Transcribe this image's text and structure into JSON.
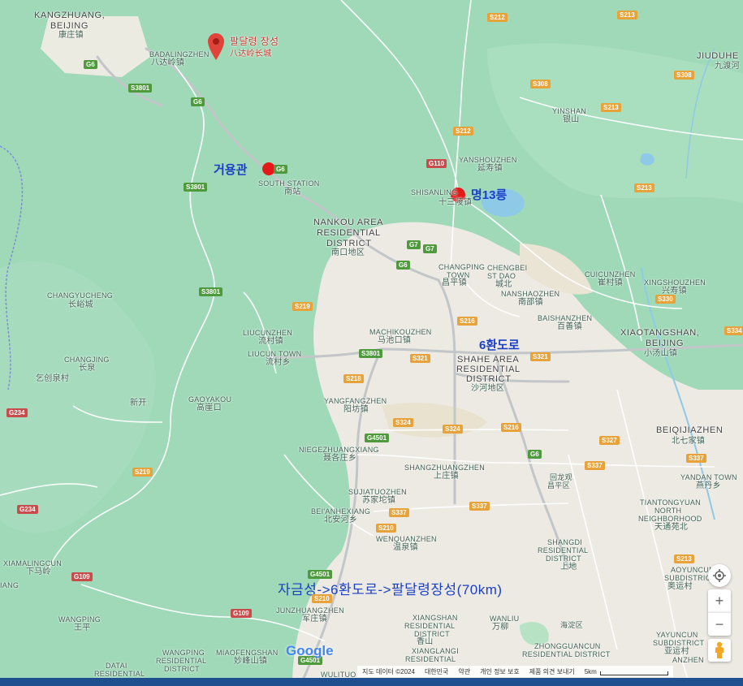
{
  "pins": {
    "badaling": {
      "title": "팔달령 장성",
      "subtitle": "八达岭长城"
    },
    "juyongguan": {
      "label": "거용관"
    },
    "ming13": {
      "label": "명13릉"
    }
  },
  "annotations": {
    "ring6": "6환도로",
    "route": "자금성->6환도로->팔달령장성(70km)"
  },
  "places": {
    "kangzhuang_en": "KANGZHUANG,",
    "kangzhuang_en2": "BEIJING",
    "kangzhuang_cn": "康庄镇",
    "badaling_en": "BADALINGZHEN",
    "badaling_cn": "八达岭镇",
    "jiudu_en": "JIUDUHE",
    "jiudu_cn": "九渡河",
    "yinshan_en": "YINSHAN",
    "yinshan_cn": "银山",
    "yanshou_en": "YANSHOUZHEN",
    "yanshou_cn": "延寿镇",
    "south_station_en": "SOUTH STATION",
    "south_station_cn": "南站",
    "shisan_en": "SHISANLING",
    "shisan_cn": "十三陵镇",
    "nankou1": "NANKOU AREA",
    "nankou2": "RESIDENTIAL",
    "nankou3": "DISTRICT",
    "nankou_cn": "南口地区",
    "changping_en": "CHANGPING",
    "changping_en2": "TOWN",
    "changping_cn": "昌平镇",
    "chengbei_en": "CHENGBEI",
    "chengbei_en2": "ST DAO",
    "chengbei_cn": "城北",
    "cuicun_en": "CUICUNZHEN",
    "cuicun_cn": "崔村镇",
    "xingshou_en": "XINGSHOUZHEN",
    "xingshou_cn": "兴寿镇",
    "nanshao_en": "NANSHAOZHEN",
    "nanshao_cn": "南邵镇",
    "changyu_en": "CHANGYUCHENG",
    "changyu_cn": "长峪城",
    "baishan_en": "BAISHANZHEN",
    "baishan_cn": "百善镇",
    "liucun_en": "LIUCUNZHEN",
    "liucun_cn": "流村镇",
    "liucun_town_en": "LIUCUN TOWN",
    "liucun_town_cn": "流村乡",
    "machi_en": "MACHIKOUZHEN",
    "machi_cn": "马池口镇",
    "xiaotang_en": "XIAOTANGSHAN,",
    "xiaotang_en2": "BEIJING",
    "xiaotang_cn": "小汤山镇",
    "changjing_en": "CHANGJING",
    "changjing_cn": "长泉",
    "shahe1": "SHAHE AREA",
    "shahe2": "RESIDENTIAL",
    "shahe3": "DISTRICT",
    "shahe_cn": "沙河地区",
    "qiying_cn": "乞创泉村",
    "xinkai_cn": "新开",
    "gaoyakou_en": "GAOYAKOU",
    "gaoyakou_cn": "高崖口",
    "yangfang_en": "YANGFANGZHEN",
    "yangfang_cn": "阳坊镇",
    "beiqijia_en": "BEIQIJIAZHEN",
    "beiqijia_cn": "北七家镇",
    "niege_en": "NIEGEZHUANGXIANG",
    "niege_cn": "聂各庄乡",
    "shangzhuang_en": "SHANGZHUANGZHEN",
    "shangzhuang_cn": "上庄镇",
    "huilongguan_cn": "回龙观",
    "yandan_en": "YANDAN TOWN",
    "yandan_cn": "燕丹乡",
    "sujia_en": "SUJIATUOZHEN",
    "sujia_cn": "苏家坨镇",
    "beian_en": "BEI'ANHEXIANG",
    "beian_cn": "北安河乡",
    "tiantong1": "TIANTONGYUAN",
    "tiantong2": "NORTH",
    "tiantong3": "NEIGHBORHOOD",
    "tiantong_cn": "天通苑北",
    "wenquan_en": "WENQUANZHEN",
    "wenquan_cn": "温泉镇",
    "shangdi1": "SHANGDI",
    "shangdi2": "RESIDENTIAL",
    "shangdi3": "DISTRICT",
    "shangdi_cn": "上地",
    "xiamaling_en": "XIAMALINGCUN",
    "xiamaling_cn": "下马岭",
    "aoyuncun1": "AOYUNCUN",
    "aoyuncun2": "SUBDISTRICT",
    "aoyuncun_cn": "奥运村",
    "junzhuang_en": "JUNZHUANGZHEN",
    "junzhuang_cn": "军庄镇",
    "xiangshan1": "XIANGSHAN",
    "xiangshan2": "RESIDENTIAL",
    "xiangshan3": "DISTRICT",
    "xiangshan_cn": "香山",
    "wanliu_en": "WANLIU",
    "wanliu_cn": "万柳",
    "haidian_cn": "海淀区",
    "wangping_en": "WANGPING",
    "wangping_cn": "王平",
    "wangping2_1": "WANGPING",
    "wangping2_2": "RESIDENTIAL",
    "wangping2_3": "DISTRICT",
    "miaofeng_en": "MIAOFENGSHAN",
    "miaofeng_cn": "妙峰山镇",
    "yayuncun1": "YAYUNCUN",
    "yayuncun2": "SUBDISTRICT",
    "yayuncun_cn": "亚运村",
    "zhongguancun1": "ZHONGGUANCUN",
    "zhongguancun2": "RESIDENTIAL DISTRICT",
    "xianglangi1": "XIANGLANGI",
    "xianglangi2": "RESIDENTIAL",
    "datai1": "DATAI",
    "datai2": "RESIDENTIAL",
    "wulituo": "WULITUO",
    "anzhen": "ANZHEN",
    "changping_district": "昌平区",
    "yang_l": "IANG"
  },
  "shields": [
    {
      "id": "S212a",
      "text": "S212"
    },
    {
      "id": "S213a",
      "text": "S213"
    },
    {
      "id": "S308a",
      "text": "S308"
    },
    {
      "id": "S308b",
      "text": "S308"
    },
    {
      "id": "S213b",
      "text": "S213"
    },
    {
      "id": "S212b",
      "text": "S212"
    },
    {
      "id": "G110",
      "text": "G110"
    },
    {
      "id": "G6a",
      "text": "G6"
    },
    {
      "id": "S3801a",
      "text": "S3801"
    },
    {
      "id": "G6b",
      "text": "G6"
    },
    {
      "id": "G6c",
      "text": "G6"
    },
    {
      "id": "S3801b",
      "text": "S3801"
    },
    {
      "id": "S213c",
      "text": "S213"
    },
    {
      "id": "G7a",
      "text": "G7"
    },
    {
      "id": "G7b",
      "text": "G7"
    },
    {
      "id": "G6d",
      "text": "G6"
    },
    {
      "id": "S3801c",
      "text": "S3801"
    },
    {
      "id": "S219a",
      "text": "S219"
    },
    {
      "id": "S330",
      "text": "S330"
    },
    {
      "id": "S216a",
      "text": "S216"
    },
    {
      "id": "S3801d",
      "text": "S3801"
    },
    {
      "id": "S321a",
      "text": "S321"
    },
    {
      "id": "S321b",
      "text": "S321"
    },
    {
      "id": "S334",
      "text": "S334"
    },
    {
      "id": "S218",
      "text": "S218"
    },
    {
      "id": "G234a",
      "text": "G234"
    },
    {
      "id": "S324a",
      "text": "S324"
    },
    {
      "id": "S324b",
      "text": "S324"
    },
    {
      "id": "S216b",
      "text": "S216"
    },
    {
      "id": "G4501a",
      "text": "G4501"
    },
    {
      "id": "S327",
      "text": "S327"
    },
    {
      "id": "G6e",
      "text": "G6"
    },
    {
      "id": "S337a",
      "text": "S337"
    },
    {
      "id": "S337b",
      "text": "S337"
    },
    {
      "id": "S219b",
      "text": "S219"
    },
    {
      "id": "G234b",
      "text": "G234"
    },
    {
      "id": "S337c",
      "text": "S337"
    },
    {
      "id": "S337d",
      "text": "S337"
    },
    {
      "id": "S210a",
      "text": "S210"
    },
    {
      "id": "S213d",
      "text": "S213"
    },
    {
      "id": "G4501b",
      "text": "G4501"
    },
    {
      "id": "G109a",
      "text": "G109"
    },
    {
      "id": "S210b",
      "text": "S210"
    },
    {
      "id": "G109b",
      "text": "G109"
    },
    {
      "id": "G4501c",
      "text": "G4501"
    }
  ],
  "controls": {
    "zoom_in": "+",
    "zoom_out": "−"
  },
  "google_logo": "Google",
  "footer": {
    "map_data": "지도 데이터 ©2024",
    "country": "대한민국",
    "terms": "약관",
    "privacy": "개인 정보 보호",
    "feedback": "제품 의견 보내기",
    "scale": "5km"
  },
  "colors": {
    "pin": "#e41a1a",
    "annotation": "#1b3fc7",
    "forest": "#9fd9b8",
    "urban": "#eceae3",
    "road": "#ffffff"
  }
}
